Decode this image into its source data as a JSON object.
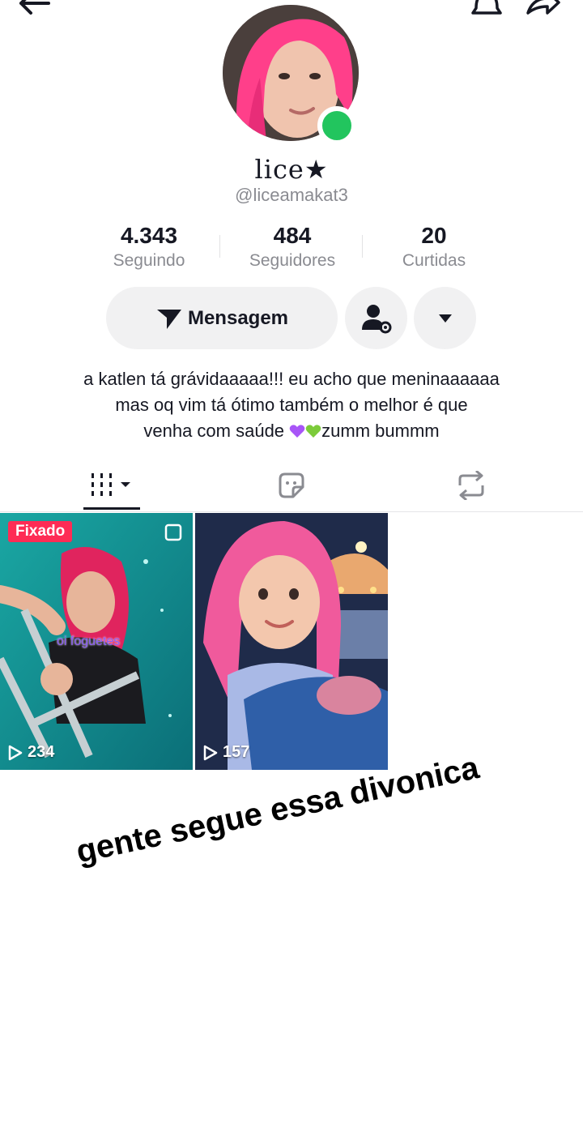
{
  "profile": {
    "display_name": "lice★",
    "username": "@liceamakat3",
    "online_color": "#22c55e"
  },
  "stats": [
    {
      "value": "4.343",
      "label": "Seguindo"
    },
    {
      "value": "484",
      "label": "Seguidores"
    },
    {
      "value": "20",
      "label": "Curtidas"
    }
  ],
  "actions": {
    "message_label": "Mensagem"
  },
  "bio": {
    "line1": "a katlen tá grávidaaaaa!!! eu acho que meninaaaaaa",
    "line2": "mas oq vim tá ótimo também o melhor é que",
    "line3_before": "venha com saúde ",
    "line3_after": "zumm bummm"
  },
  "tabs": [
    {
      "icon": "grid-icon",
      "active": true
    },
    {
      "icon": "sticker-icon",
      "active": false
    },
    {
      "icon": "repost-icon",
      "active": false
    }
  ],
  "videos": [
    {
      "badge": "Fixado",
      "views": "234",
      "overlay_text": "oi foguetes"
    },
    {
      "views": "157"
    }
  ],
  "caption": "gente segue essa divonica",
  "colors": {
    "accent": "#fe2c55",
    "secondary_text": "#8a8b91",
    "button_bg": "#f1f1f2"
  }
}
